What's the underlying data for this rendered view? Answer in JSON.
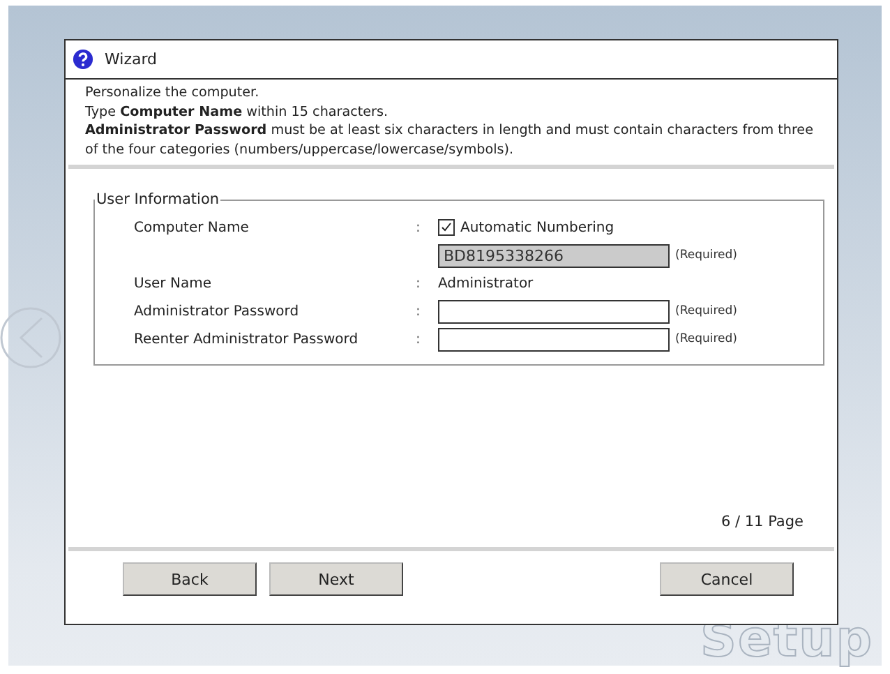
{
  "window": {
    "title": "Wizard"
  },
  "instructions": [
    "Personalize the computer.",
    "Type **Computer Name** within 15 characters.",
    "**Administrator Password** must be at least six characters in length and must contain characters from three of the four categories (numbers/uppercase/lowercase/symbols)."
  ],
  "group": {
    "title": "User Information",
    "rows": [
      {
        "kind": "checkbox",
        "label": "Computer Name",
        "separator": ":",
        "option": "Automatic Numbering",
        "checked": true
      },
      {
        "kind": "field",
        "value": "BD8195338266",
        "disabled": true,
        "note": "(Required)"
      },
      {
        "kind": "text",
        "label": "User Name",
        "separator": ":",
        "value": "Administrator"
      },
      {
        "kind": "field",
        "label": "Administrator Password",
        "separator": ":",
        "disabled": false,
        "note": "(Required)"
      },
      {
        "kind": "field",
        "label": "Reenter Administrator Password",
        "separator": ":",
        "disabled": false,
        "note": "(Required)"
      }
    ]
  },
  "page_indicator": "6 / 11 Page",
  "buttons_left": [
    "Back",
    "Next"
  ],
  "buttons_right": [
    "Cancel"
  ],
  "background_text": "Setup"
}
